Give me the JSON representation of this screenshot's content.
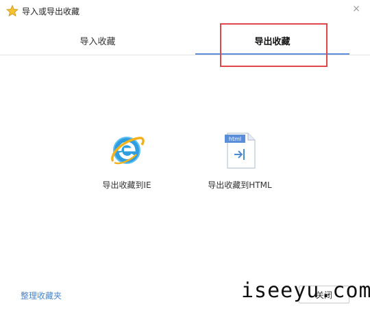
{
  "window": {
    "title": "导入或导出收藏",
    "close_glyph": "×"
  },
  "tabs": {
    "import_label": "导入收藏",
    "export_label": "导出收藏",
    "active": "export"
  },
  "options": {
    "ie_label": "导出收藏到IE",
    "html_label": "导出收藏到HTML",
    "html_badge": "html"
  },
  "footer": {
    "manage_link": "整理收藏夹",
    "close_button": "关闭"
  },
  "watermark": "iseeyu.com",
  "colors": {
    "accent": "#5a8ed8",
    "highlight": "#e0454a",
    "link": "#4a86c8"
  },
  "icons": {
    "title": "star-icon",
    "ie": "internet-explorer-icon",
    "html": "html-file-icon"
  }
}
